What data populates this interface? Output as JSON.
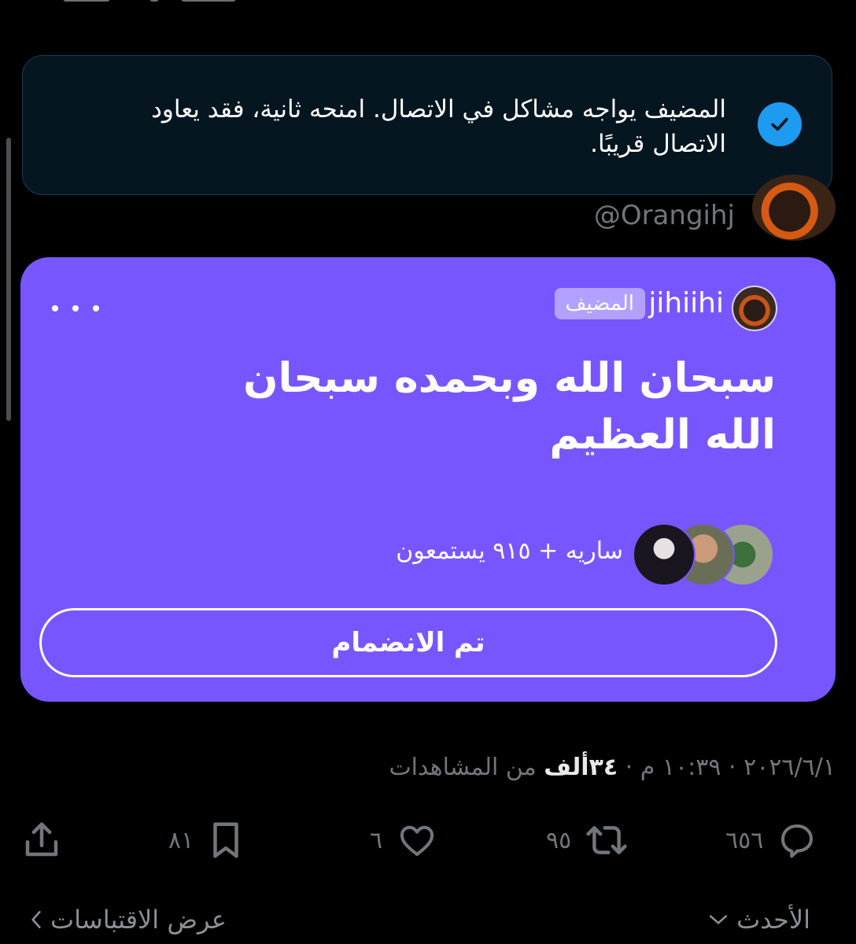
{
  "toast": {
    "message": "المضيف يواجه مشاكل في الاتصال. امنحه ثانية، فقد يعاود الاتصال قريبًا.",
    "icon": "check-circle-icon"
  },
  "profile": {
    "handle": "@Orangihj"
  },
  "space": {
    "host_name": "jihiihi",
    "host_badge": "المضيف",
    "title": "سبحان الله وبحمده سبحان الله العظيم",
    "listeners_text": "ساريه + ٩١٥ يستمعون",
    "join_label": "تم الانضمام",
    "card_color": "#7856ff"
  },
  "meta": {
    "date_time": "٢٠٢٦/٦/١ · ١٠:٣٩ م · ",
    "views_count": "٣٤ألف",
    "views_label": " من المشاهدات"
  },
  "actions": {
    "replies": "٦٥٦",
    "reposts": "٩٥",
    "likes": "٦",
    "bookmarks": "٨١"
  },
  "footer": {
    "sort_label": "الأحدث",
    "quotes_label": "عرض الاقتباسات"
  },
  "colors": {
    "accent_blue": "#1d9bf0",
    "toast_bg": "#061621"
  }
}
